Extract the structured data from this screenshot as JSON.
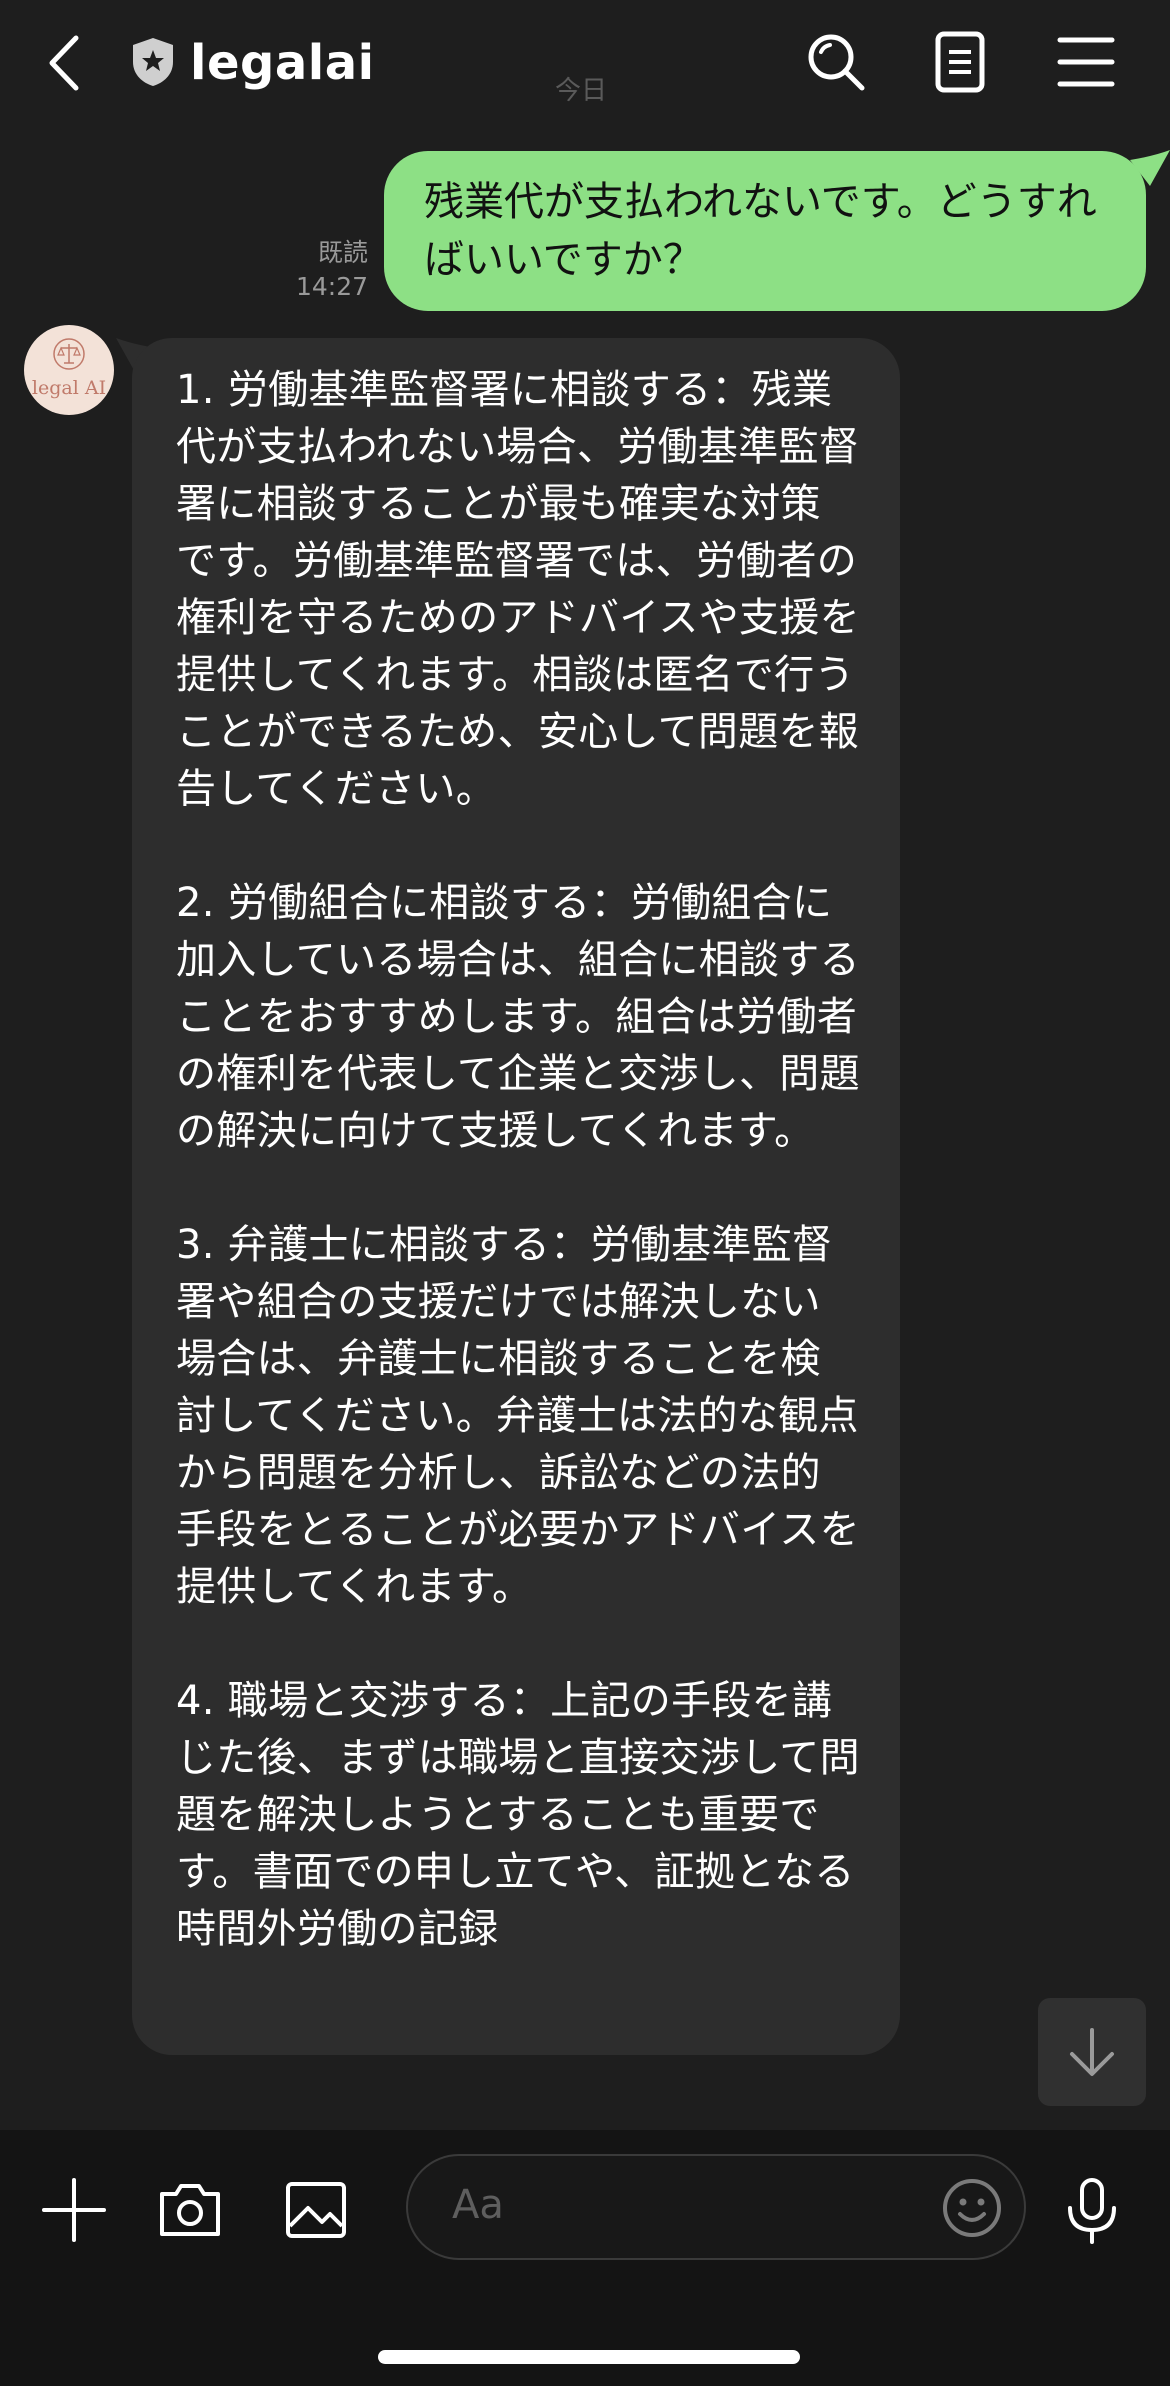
{
  "header": {
    "title": "legalai",
    "date_label": "今日",
    "icons": [
      "back-icon",
      "shield-icon",
      "search-icon",
      "notes-icon",
      "menu-icon"
    ]
  },
  "messages": {
    "sent": {
      "text": "残業代が支払われないです。どうすればいいですか？",
      "read_label": "既読",
      "time": "14:27"
    },
    "received": {
      "sender_avatar_label": "legal AI",
      "paragraphs": [
        "1. 労働基準監督署に相談する：残業代が支払われない場合、労働基準監督署に相談することが最も確実な対策です。労働基準監督署では、労働者の権利を守るためのアドバイスや支援を提供してくれます。相談は匿名で行うことができるため、安心して問題を報告してください。",
        "2. 労働組合に相談する：労働組合に加入している場合は、組合に相談することをおすすめします。組合は労働者の権利を代表して企業と交渉し、問題の解決に向けて支援してくれます。",
        "3. 弁護士に相談する：労働基準監督署や組合の支援だけでは解決しない場合は、弁護士に相談することを検討してください。弁護士は法的な観点から問題を分析し、訴訟などの法的手段をとることが必要かアドバイスを提供してくれます。",
        "4. 職場と交渉する：上記の手段を講じた後、まずは職場と直接交渉して問題を解決しようとすることも重要です。書面での申し立てや、証拠となる時間外労働の記録"
      ]
    }
  },
  "footer": {
    "input_placeholder": "Aa",
    "icons": [
      "plus-icon",
      "camera-icon",
      "image-icon",
      "emoji-icon",
      "microphone-icon"
    ]
  },
  "colors": {
    "background": "#1e1e1e",
    "sent_bubble": "#8de085",
    "received_bubble": "#2d2d2d",
    "footer": "#141414"
  }
}
